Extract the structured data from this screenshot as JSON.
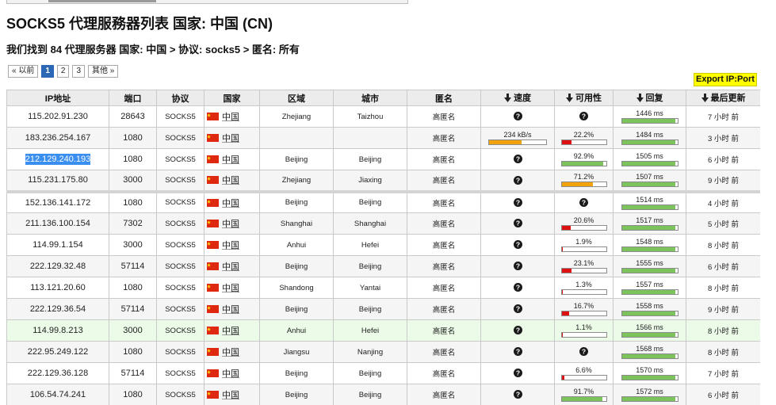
{
  "page": {
    "title": "SOCKS5 代理服務器列表 国家: 中国 (CN)",
    "summary": "我们找到 84 代理服务器 国家: 中国 > 协议: socks5 > 匿名: 所有"
  },
  "pagination": {
    "prev_label": "« 以前",
    "pages": [
      "1",
      "2",
      "3"
    ],
    "current_page": "1",
    "more_label": "其他 »"
  },
  "export": {
    "label": "Export IP:Port"
  },
  "colors": {
    "export_bg": "#ffff00",
    "active_page": "#2b67b4",
    "bar_green": "#7cc35b",
    "bar_orange": "#f2a20c",
    "bar_red": "#dd1111",
    "hover_row": "#ebfbe7",
    "selection": "#3a8ef0"
  },
  "table": {
    "headers": [
      {
        "label": "IP地址"
      },
      {
        "label": "端口"
      },
      {
        "label": "协议"
      },
      {
        "label": "国家"
      },
      {
        "label": "区域"
      },
      {
        "label": "城市"
      },
      {
        "label": "匿名"
      },
      {
        "label": "速度",
        "sort_icon": "sort-down-arrow-icon"
      },
      {
        "label": "可用性",
        "sort_icon": "sort-down-arrow-icon"
      },
      {
        "label": "回复",
        "sort_icon": "sort-down-arrow-icon"
      },
      {
        "label": "最后更新",
        "sort_icon": "sort-down-arrow-icon"
      }
    ],
    "rows": [
      {
        "ip": "115.202.91.230",
        "port": "28643",
        "protocol": "SOCKS5",
        "flag": "china-flag-icon",
        "country": "中国",
        "region": "Zhejiang",
        "city": "Taizhou",
        "anonymity": "高匿名",
        "speed": {
          "icon": "question-circle-icon"
        },
        "availability": {
          "icon": "question-circle-icon"
        },
        "response": {
          "label": "1446 ms",
          "fill": 0.97,
          "color": "#7cc35b"
        },
        "updated": "7 小时 前"
      },
      {
        "ip": "183.236.254.167",
        "port": "1080",
        "protocol": "SOCKS5",
        "flag": "china-flag-icon",
        "country": "中国",
        "region": "",
        "city": "",
        "anonymity": "高匿名",
        "speed": {
          "label": "234 kB/s",
          "fill": 0.57,
          "color": "#f2a20c"
        },
        "availability": {
          "label": "22.2%",
          "fill": 0.222,
          "color": "#dd1111"
        },
        "response": {
          "label": "1484 ms",
          "fill": 0.97,
          "color": "#7cc35b"
        },
        "updated": "3 小时 前"
      },
      {
        "ip": "212.129.240.193",
        "port": "1080",
        "protocol": "SOCKS5",
        "flag": "china-flag-icon",
        "country": "中国",
        "region": "Beijing",
        "city": "Beijing",
        "anonymity": "高匿名",
        "speed": {
          "icon": "question-circle-icon"
        },
        "availability": {
          "label": "92.9%",
          "fill": 0.929,
          "color": "#7cc35b"
        },
        "response": {
          "label": "1505 ms",
          "fill": 0.97,
          "color": "#7cc35b"
        },
        "updated": "6 小时 前"
      },
      {
        "ip": "115.231.175.80",
        "port": "3000",
        "protocol": "SOCKS5",
        "flag": "china-flag-icon",
        "country": "中国",
        "region": "Zhejiang",
        "city": "Jiaxing",
        "anonymity": "高匿名",
        "speed": {
          "icon": "question-circle-icon"
        },
        "availability": {
          "label": "71.2%",
          "fill": 0.712,
          "color": "#f2a20c"
        },
        "response": {
          "label": "1507 ms",
          "fill": 0.97,
          "color": "#7cc35b"
        },
        "updated": "9 小时 前"
      },
      {
        "ip": "152.136.141.172",
        "port": "1080",
        "protocol": "SOCKS5",
        "flag": "china-flag-icon",
        "country": "中国",
        "region": "Beijing",
        "city": "Beijing",
        "anonymity": "高匿名",
        "speed": {
          "icon": "question-circle-icon"
        },
        "availability": {
          "icon": "question-circle-icon"
        },
        "response": {
          "label": "1514 ms",
          "fill": 0.97,
          "color": "#7cc35b"
        },
        "updated": "4 小时 前"
      },
      {
        "ip": "211.136.100.154",
        "port": "7302",
        "protocol": "SOCKS5",
        "flag": "china-flag-icon",
        "country": "中国",
        "region": "Shanghai",
        "city": "Shanghai",
        "anonymity": "高匿名",
        "speed": {
          "icon": "question-circle-icon"
        },
        "availability": {
          "label": "20.6%",
          "fill": 0.206,
          "color": "#dd1111"
        },
        "response": {
          "label": "1517 ms",
          "fill": 0.97,
          "color": "#7cc35b"
        },
        "updated": "5 小时 前"
      },
      {
        "ip": "114.99.1.154",
        "port": "3000",
        "protocol": "SOCKS5",
        "flag": "china-flag-icon",
        "country": "中国",
        "region": "Anhui",
        "city": "Hefei",
        "anonymity": "高匿名",
        "speed": {
          "icon": "question-circle-icon"
        },
        "availability": {
          "label": "1.9%",
          "fill": 0.019,
          "color": "#dd1111"
        },
        "response": {
          "label": "1548 ms",
          "fill": 0.97,
          "color": "#7cc35b"
        },
        "updated": "8 小时 前"
      },
      {
        "ip": "222.129.32.48",
        "port": "57114",
        "protocol": "SOCKS5",
        "flag": "china-flag-icon",
        "country": "中国",
        "region": "Beijing",
        "city": "Beijing",
        "anonymity": "高匿名",
        "speed": {
          "icon": "question-circle-icon"
        },
        "availability": {
          "label": "23.1%",
          "fill": 0.231,
          "color": "#dd1111"
        },
        "response": {
          "label": "1555 ms",
          "fill": 0.97,
          "color": "#7cc35b"
        },
        "updated": "6 小时 前"
      },
      {
        "ip": "113.121.20.60",
        "port": "1080",
        "protocol": "SOCKS5",
        "flag": "china-flag-icon",
        "country": "中国",
        "region": "Shandong",
        "city": "Yantai",
        "anonymity": "高匿名",
        "speed": {
          "icon": "question-circle-icon"
        },
        "availability": {
          "label": "1.3%",
          "fill": 0.013,
          "color": "#dd1111"
        },
        "response": {
          "label": "1557 ms",
          "fill": 0.97,
          "color": "#7cc35b"
        },
        "updated": "8 小时 前"
      },
      {
        "ip": "222.129.36.54",
        "port": "57114",
        "protocol": "SOCKS5",
        "flag": "china-flag-icon",
        "country": "中国",
        "region": "Beijing",
        "city": "Beijing",
        "anonymity": "高匿名",
        "speed": {
          "icon": "question-circle-icon"
        },
        "availability": {
          "label": "16.7%",
          "fill": 0.167,
          "color": "#dd1111"
        },
        "response": {
          "label": "1558 ms",
          "fill": 0.97,
          "color": "#7cc35b"
        },
        "updated": "9 小时 前"
      },
      {
        "ip": "114.99.8.213",
        "port": "3000",
        "protocol": "SOCKS5",
        "flag": "china-flag-icon",
        "country": "中国",
        "region": "Anhui",
        "city": "Hefei",
        "anonymity": "高匿名",
        "speed": {
          "icon": "question-circle-icon"
        },
        "availability": {
          "label": "1.1%",
          "fill": 0.011,
          "color": "#dd1111"
        },
        "response": {
          "label": "1566 ms",
          "fill": 0.97,
          "color": "#7cc35b"
        },
        "updated": "8 小时 前"
      },
      {
        "ip": "222.95.249.122",
        "port": "1080",
        "protocol": "SOCKS5",
        "flag": "china-flag-icon",
        "country": "中国",
        "region": "Jiangsu",
        "city": "Nanjing",
        "anonymity": "高匿名",
        "speed": {
          "icon": "question-circle-icon"
        },
        "availability": {
          "icon": "question-circle-icon"
        },
        "response": {
          "label": "1568 ms",
          "fill": 0.97,
          "color": "#7cc35b"
        },
        "updated": "8 小时 前"
      },
      {
        "ip": "222.129.36.128",
        "port": "57114",
        "protocol": "SOCKS5",
        "flag": "china-flag-icon",
        "country": "中国",
        "region": "Beijing",
        "city": "Beijing",
        "anonymity": "高匿名",
        "speed": {
          "icon": "question-circle-icon"
        },
        "availability": {
          "label": "6.6%",
          "fill": 0.066,
          "color": "#dd1111"
        },
        "response": {
          "label": "1570 ms",
          "fill": 0.97,
          "color": "#7cc35b"
        },
        "updated": "7 小时 前"
      },
      {
        "ip": "106.54.74.241",
        "port": "1080",
        "protocol": "SOCKS5",
        "flag": "china-flag-icon",
        "country": "中国",
        "region": "Beijing",
        "city": "Beijing",
        "anonymity": "高匿名",
        "speed": {
          "icon": "question-circle-icon"
        },
        "availability": {
          "label": "91.7%",
          "fill": 0.917,
          "color": "#7cc35b"
        },
        "response": {
          "label": "1572 ms",
          "fill": 0.97,
          "color": "#7cc35b"
        },
        "updated": "6 小时 前"
      }
    ]
  }
}
